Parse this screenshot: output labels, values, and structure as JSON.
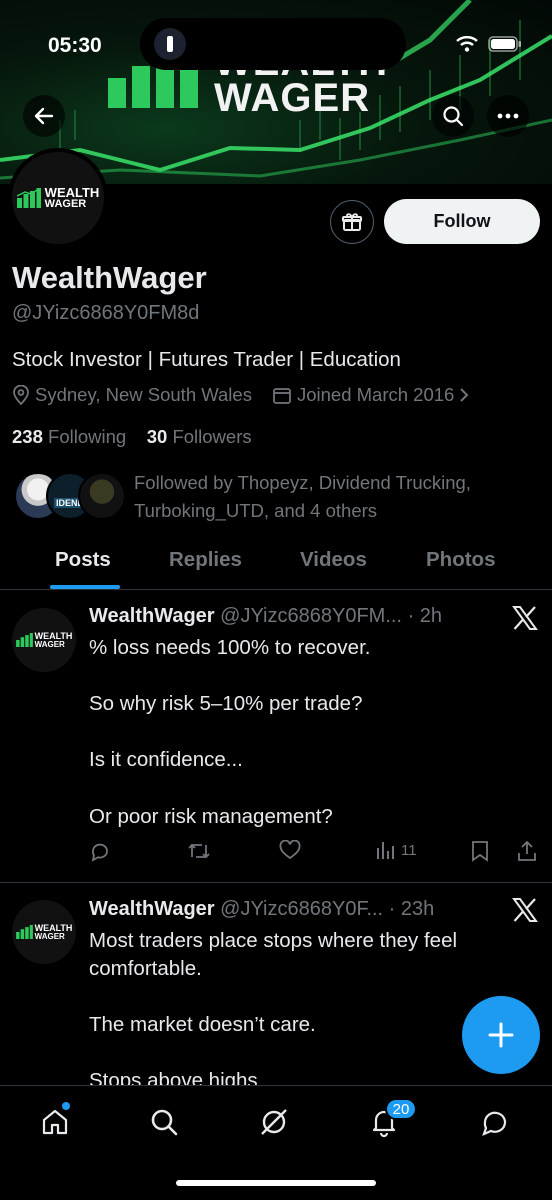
{
  "status_bar": {
    "time": "05:30"
  },
  "banner": {
    "brand_top": "WEALTH",
    "brand_bottom": "WAGER"
  },
  "avatar": {
    "line1": "WEALTH",
    "line2": "WAGER"
  },
  "profile": {
    "follow_label": "Follow",
    "name": "WealthWager",
    "handle": "@JYizc6868Y0FM8d",
    "bio": "Stock Investor | Futures Trader | Education",
    "location": "Sydney, New South Wales",
    "joined": "Joined March 2016",
    "following_count": "238",
    "following_label": "Following",
    "followers_count": "30",
    "followers_label": "Followers",
    "followed_by_line1": "Followed by Thopeyz, Dividend Trucking,",
    "followed_by_line2": "Turboking_UTD, and 4 others",
    "followed_avatar_text": "IDEND"
  },
  "tabs": [
    {
      "label": "Posts",
      "active": true
    },
    {
      "label": "Replies",
      "active": false
    },
    {
      "label": "Videos",
      "active": false
    },
    {
      "label": "Photos",
      "active": false
    }
  ],
  "posts": [
    {
      "name": "WealthWager",
      "handle": "@JYizc6868Y0FM...",
      "time": "· 2h",
      "lines": [
        "% loss needs 100% to recover.",
        "So why risk 5–10% per trade?",
        "Is it confidence...",
        "Or poor risk management?"
      ],
      "views": "11"
    },
    {
      "name": "WealthWager",
      "handle": "@JYizc6868Y0F...",
      "time": "· 23h",
      "lines": [
        "Most traders place stops where they feel",
        "comfortable.",
        "The market doesn’t care.",
        "Stops above highs"
      ]
    }
  ],
  "bottom_nav": {
    "notifications_count": "20"
  },
  "colors": {
    "accent": "#1d9bf0",
    "background": "#000000",
    "muted": "#71767b",
    "brand_green": "#2ec95c"
  }
}
